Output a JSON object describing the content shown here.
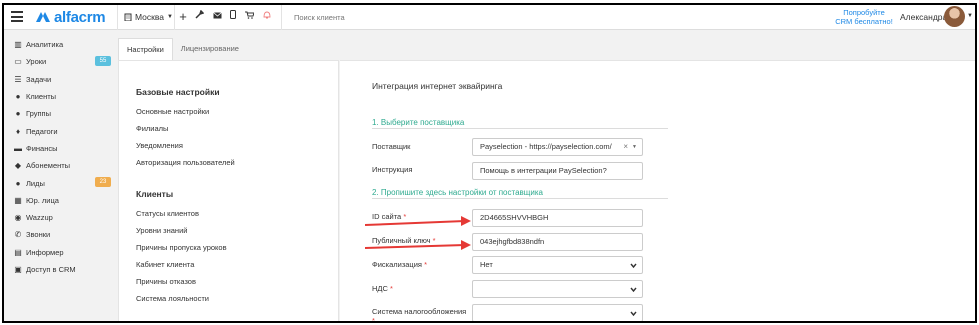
{
  "topbar": {
    "logo_text": "alfacrm",
    "city": "Москва",
    "search_placeholder": "Поиск клиента",
    "try_line1": "Попробуйте",
    "try_line2": "CRM бесплатно!",
    "user_name": "Александра",
    "brand_color": "#1e88e5"
  },
  "sidebar": {
    "items": [
      {
        "label": "Аналитика",
        "icon": "analytics-icon"
      },
      {
        "label": "Уроки",
        "icon": "calendar-icon",
        "badge": "55",
        "badge_color": "#5bc0de"
      },
      {
        "label": "Задачи",
        "icon": "tasks-icon"
      },
      {
        "label": "Клиенты",
        "icon": "user-icon"
      },
      {
        "label": "Группы",
        "icon": "users-icon"
      },
      {
        "label": "Педагоги",
        "icon": "graduation-icon"
      },
      {
        "label": "Финансы",
        "icon": "money-icon"
      },
      {
        "label": "Абонементы",
        "icon": "tag-icon"
      },
      {
        "label": "Лиды",
        "icon": "user-plus-icon",
        "badge": "23",
        "badge_color": "#f0ad4e"
      },
      {
        "label": "Юр. лица",
        "icon": "building-icon"
      },
      {
        "label": "Wazzup",
        "icon": "whatsapp-icon"
      },
      {
        "label": "Звонки",
        "icon": "phone-icon"
      },
      {
        "label": "Информер",
        "icon": "informer-icon"
      },
      {
        "label": "Доступ в CRM",
        "icon": "lock-icon"
      }
    ]
  },
  "tabs": [
    {
      "label": "Настройки",
      "active": true
    },
    {
      "label": "Лицензирование",
      "active": false
    }
  ],
  "settings_menu": {
    "basic_title": "Базовые настройки",
    "basic_items": [
      "Основные настройки",
      "Филиалы",
      "Уведомления",
      "Авторизация пользователей"
    ],
    "clients_title": "Клиенты",
    "clients_items": [
      "Статусы клиентов",
      "Уровни знаний",
      "Причины пропуска уроков",
      "Кабинет клиента",
      "Причины отказов",
      "Система лояльности"
    ]
  },
  "form": {
    "title": "Интеграция интернет эквайринга",
    "step1": "1. Выберите поставщика",
    "step2": "2. Пропишите здесь настройки от поставщика",
    "provider_label": "Поставщик",
    "provider_value": "Payselection - https://payselection.com/",
    "instruction_label": "Инструкция",
    "instruction_value": "Помощь в интеграции PaySelection?",
    "site_id_label": "ID сайта",
    "site_id_value": "2D4665SHVVHBGH",
    "public_key_label": "Публичный ключ",
    "public_key_value": "043ejhgfbd838ndfn",
    "fiscal_label": "Фискализация",
    "fiscal_value": "Нет",
    "vat_label": "НДС",
    "vat_value": "",
    "tax_label": "Система налогообложения",
    "tax_value": "",
    "required_mark": "*",
    "accent_color": "#2eaa8f",
    "arrow_color": "#e53935"
  }
}
